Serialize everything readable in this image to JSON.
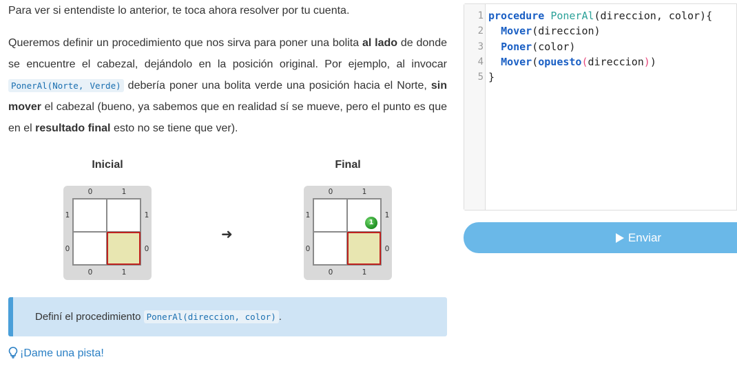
{
  "intro": "Para ver si entendiste lo anterior, te toca ahora resolver por tu cuenta.",
  "paragraph": {
    "t1": "Queremos definir un procedimiento que nos sirva para poner una bolita ",
    "b1": "al lado",
    "t2": " de donde se encuentre el cabezal, dejándolo en la posición original. Por ejemplo, al invocar ",
    "code": "PonerAl(Norte, Verde)",
    "t3": " debería poner una bolita verde una posición hacia el Norte, ",
    "b2": "sin mover",
    "t4": " el cabezal (bueno, ya sabemos que en realidad sí se mueve, pero el punto es que en el ",
    "b3": "resultado final",
    "t5": " esto no se tiene que ver)."
  },
  "boards": {
    "initial": {
      "title": "Inicial",
      "col_labels": [
        "0",
        "1"
      ],
      "row_labels": [
        "1",
        "0"
      ],
      "head": {
        "col": 1,
        "row": 0
      },
      "balls": []
    },
    "final": {
      "title": "Final",
      "col_labels": [
        "0",
        "1"
      ],
      "row_labels": [
        "1",
        "0"
      ],
      "head": {
        "col": 1,
        "row": 0
      },
      "balls": [
        {
          "col": 1,
          "row": 1,
          "color": "green",
          "count": "1"
        }
      ]
    },
    "arrow": "➜"
  },
  "callout": {
    "text": "Definí el procedimiento ",
    "code": "PonerAl(direccion, color)",
    "suffix": "."
  },
  "hint": "¡Dame una pista!",
  "editor": {
    "line_numbers": [
      "1",
      "2",
      "3",
      "4",
      "5"
    ],
    "lines": [
      {
        "kw": "procedure",
        "fn": "PonerAl",
        "rest": "(direccion, color){"
      },
      {
        "indent": "  ",
        "fn": "Mover",
        "rest": "(direccion)"
      },
      {
        "indent": "  ",
        "fn": "Poner",
        "rest": "(color)"
      },
      {
        "indent": "  ",
        "fn": "Mover",
        "p1": "(",
        "fn2": "opuesto",
        "p2": "(",
        "arg": "direccion",
        "p3": ")",
        "p4": ")"
      },
      {
        "rest": "}"
      }
    ]
  },
  "send_button": "Enviar",
  "colors": {
    "accent": "#6ab8e8",
    "callout_bg": "#cfe4f5",
    "callout_border": "#4a9fd9",
    "head_border": "#c0221f",
    "head_fill": "#e8e6b1",
    "ball_green": "#2ea12f",
    "link": "#2a7fc4"
  }
}
